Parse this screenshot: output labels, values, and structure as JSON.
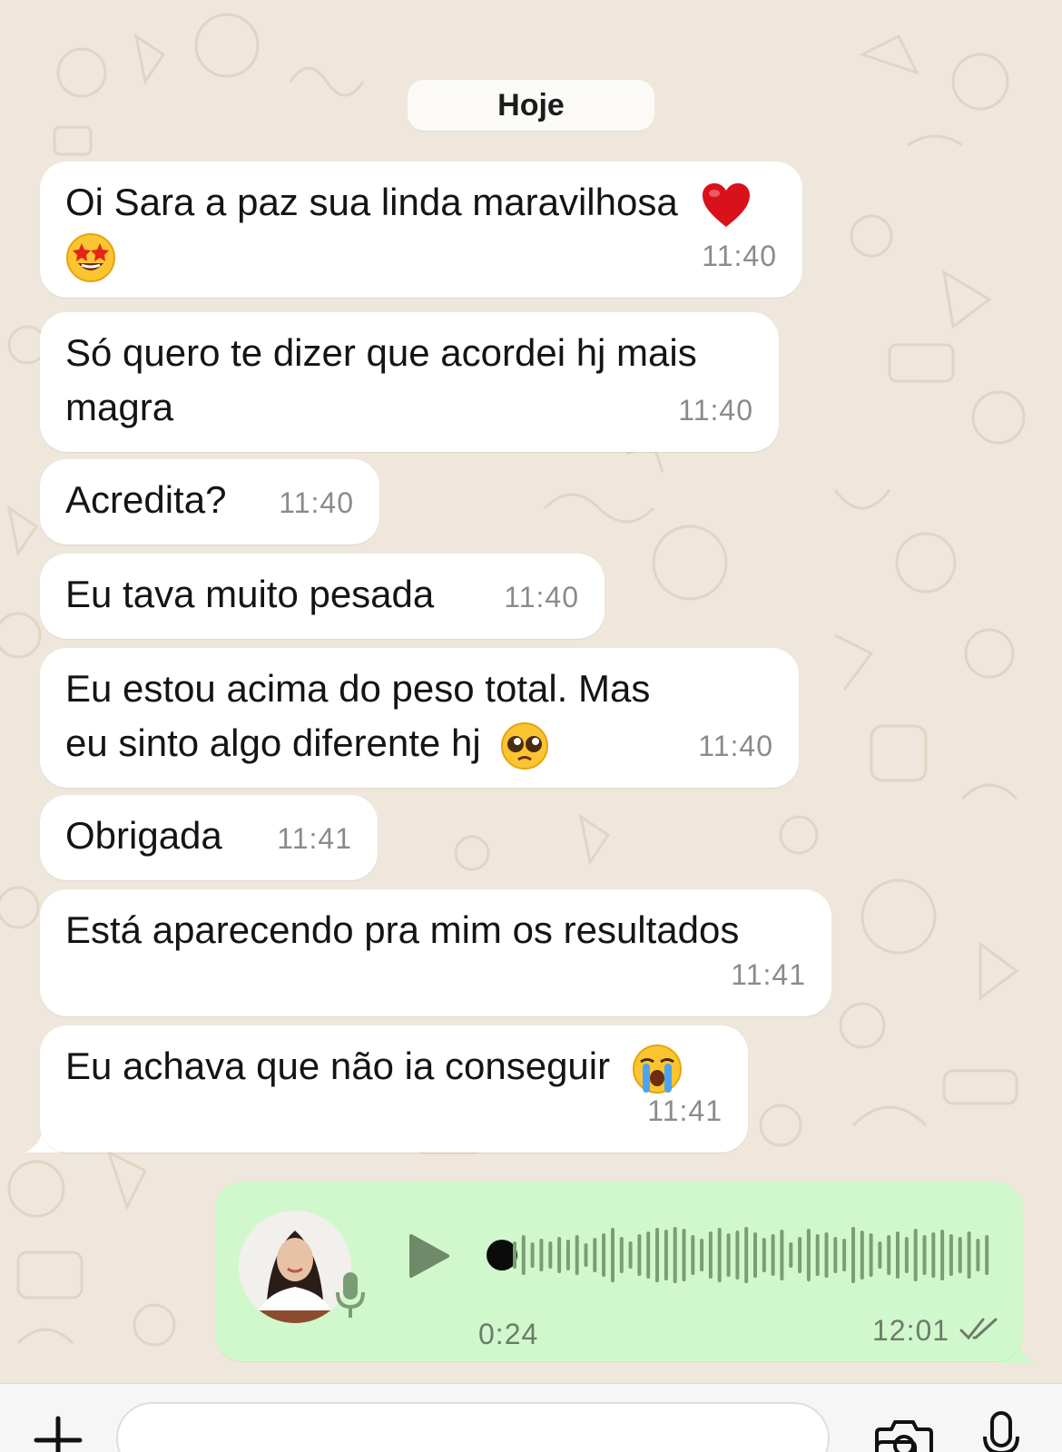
{
  "date_separator": "Hoje",
  "messages": [
    {
      "text": "Oi Sara a paz sua linda maravilhosa",
      "emoji": [
        "red-heart",
        "star-struck"
      ],
      "time": "11:40"
    },
    {
      "text": "Só quero te dizer que acordei hj mais magra",
      "time": "11:40"
    },
    {
      "text": "Acredita?",
      "time": "11:40"
    },
    {
      "text": "Eu tava muito pesada",
      "time": "11:40"
    },
    {
      "text": "Eu estou acima do peso total. Mas eu sinto algo diferente hj",
      "emoji": [
        "pleading-face"
      ],
      "time": "11:40"
    },
    {
      "text": "Obrigada",
      "time": "11:41"
    },
    {
      "text": "Está aparecendo pra mim os resultados",
      "time": "11:41"
    },
    {
      "text": "Eu achava que não ia conseguir",
      "emoji": [
        "loudly-crying-face"
      ],
      "time": "11:41"
    }
  ],
  "voice_message": {
    "duration": "0:24",
    "time": "12:01",
    "status": "read",
    "progress": 0
  },
  "input_bar": {
    "icons": [
      "plus-icon",
      "sticker-icon",
      "camera-icon",
      "microphone-icon"
    ]
  },
  "colors": {
    "chat_background": "#efe7dc",
    "incoming_bubble": "#ffffff",
    "outgoing_bubble": "#d1f8cc",
    "timestamp": "#8b8b8b",
    "waveform": "#7a9e74"
  }
}
